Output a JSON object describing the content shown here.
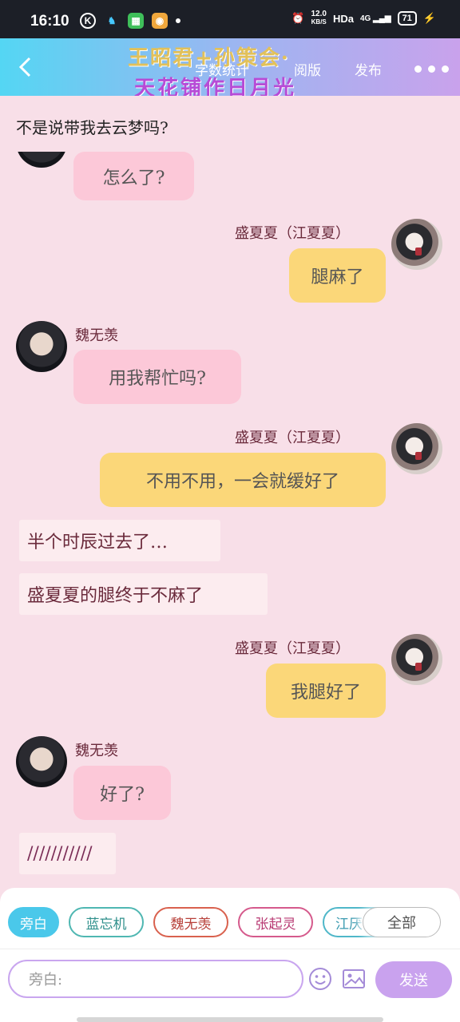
{
  "status_bar": {
    "time": "16:10",
    "speed_value": "12.0",
    "speed_unit": "KB/S",
    "hd_label": "HDa",
    "signal": "4G",
    "battery": "71"
  },
  "header": {
    "nav_1": "字数统计",
    "nav_2": "阅版",
    "nav_3": "发布",
    "overlay_line_1": "王昭君+孙策会·",
    "overlay_line_2": "天花铺作日月光"
  },
  "chat": {
    "top_text": "不是说带我去云梦吗?",
    "messages": [
      {
        "side": "left",
        "name": "",
        "text": "怎么了?"
      },
      {
        "side": "right",
        "name": "盛夏夏（江夏夏）",
        "text": "腿麻了"
      },
      {
        "side": "left",
        "name": "魏无羡",
        "text": "用我帮忙吗?"
      },
      {
        "side": "right",
        "name": "盛夏夏（江夏夏）",
        "text": "不用不用，一会就缓好了"
      },
      {
        "side": "narration",
        "text": "半个时辰过去了…"
      },
      {
        "side": "narration",
        "text": "盛夏夏的腿终于不麻了"
      },
      {
        "side": "right",
        "name": "盛夏夏（江夏夏）",
        "text": "我腿好了"
      },
      {
        "side": "left",
        "name": "魏无羡",
        "text": "好了?"
      },
      {
        "side": "narration",
        "text": "///////////"
      }
    ]
  },
  "panel": {
    "chips": [
      "旁白",
      "蓝忘机",
      "魏无羡",
      "张起灵",
      "江厌离"
    ],
    "all_label": "全部",
    "input_placeholder": "旁白:",
    "send_label": "发送"
  },
  "colors": {
    "chat_bg": "#f8dfe8",
    "left_bubble": "#fcc8d8",
    "right_bubble": "#fbd779",
    "accent": "#c9a2ee"
  }
}
